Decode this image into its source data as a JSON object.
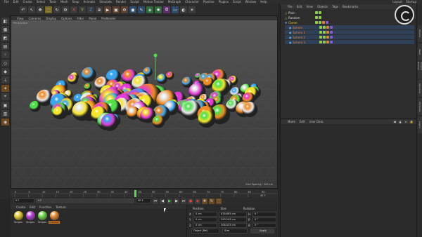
{
  "menubar": {
    "items": [
      "File",
      "Edit",
      "Create",
      "Select",
      "Tools",
      "Mesh",
      "Snap",
      "Animate",
      "Simulate",
      "Render",
      "Sculpt",
      "Motion Tracker",
      "MoGraph",
      "Character",
      "Pipeline",
      "Plugins",
      "Script",
      "Window",
      "Help"
    ],
    "layout_label": "Layout:",
    "layout_value": "Startup"
  },
  "viewport": {
    "menu": [
      "View",
      "Cameras",
      "Display",
      "Options",
      "Filter",
      "Panel",
      "ProRender"
    ],
    "camera_label": "Perspective",
    "grid_spacing": "Grid Spacing : 100 cm",
    "colors": [
      "#f5e52a",
      "#e23bd6",
      "#3aa6f0",
      "#4fe04a",
      "#f08a22",
      "#e8e8e8"
    ]
  },
  "timeline": {
    "ticks": [
      "0",
      "5",
      "10",
      "15",
      "20",
      "25",
      "30",
      "35",
      "40",
      "45",
      "50",
      "55",
      "60",
      "65",
      "70",
      "75",
      "80",
      "85",
      "90"
    ],
    "end_label": "41 F"
  },
  "playbar": {
    "start_field": "0 F",
    "current_field": "0 F",
    "end_field": "90 F",
    "max_field": "90 F"
  },
  "materials": {
    "menu": [
      "Create",
      "Edit",
      "Function",
      "Texture"
    ],
    "items": [
      {
        "label": "Stripes",
        "color": "#e0c930"
      },
      {
        "label": "Stripes",
        "color": "#b93fd4"
      },
      {
        "label": "Stripes",
        "color": "#6fd24b"
      },
      {
        "label": "Checker",
        "color": "#e58a2e"
      }
    ]
  },
  "coords": {
    "headers": [
      "Position",
      "Size",
      "Rotation"
    ],
    "rows": [
      {
        "axis": "X",
        "pos": "0 cm",
        "size": "878.695 cm",
        "rot_axis": "H",
        "rot": "0 °"
      },
      {
        "axis": "Y",
        "pos": "0 cm",
        "size": "293.243 cm",
        "rot_axis": "P",
        "rot": "0 °"
      },
      {
        "axis": "Z",
        "pos": "0 cm",
        "size": "308.533 cm",
        "rot_axis": "B",
        "rot": "0 °"
      }
    ],
    "mode_object": "Object (Rel)",
    "mode_size": "Size",
    "apply_label": "Apply"
  },
  "objects": {
    "menu": [
      "File",
      "Edit",
      "View",
      "Objects",
      "Tags",
      "Bookmarks"
    ],
    "rows": [
      {
        "name": "Plain",
        "color": "#ddd",
        "indent": 0
      },
      {
        "name": "Random",
        "color": "#ddd",
        "indent": 0
      },
      {
        "name": "Cloner",
        "color": "#f0c93a",
        "indent": 0
      },
      {
        "name": "Sphere",
        "color": "#e0813a",
        "indent": 6
      },
      {
        "name": "Sphere.1",
        "color": "#e0813a",
        "indent": 6
      },
      {
        "name": "Sphere.2",
        "color": "#e0813a",
        "indent": 6
      },
      {
        "name": "Sphere.3",
        "color": "#e0813a",
        "indent": 6
      }
    ]
  },
  "attributes": {
    "menu": [
      "Mode",
      "Edit",
      "User Data"
    ]
  },
  "right_tabs": [
    "Objects",
    "Takes",
    "Content Browser",
    "Structure",
    "Attributes",
    "Layers"
  ]
}
